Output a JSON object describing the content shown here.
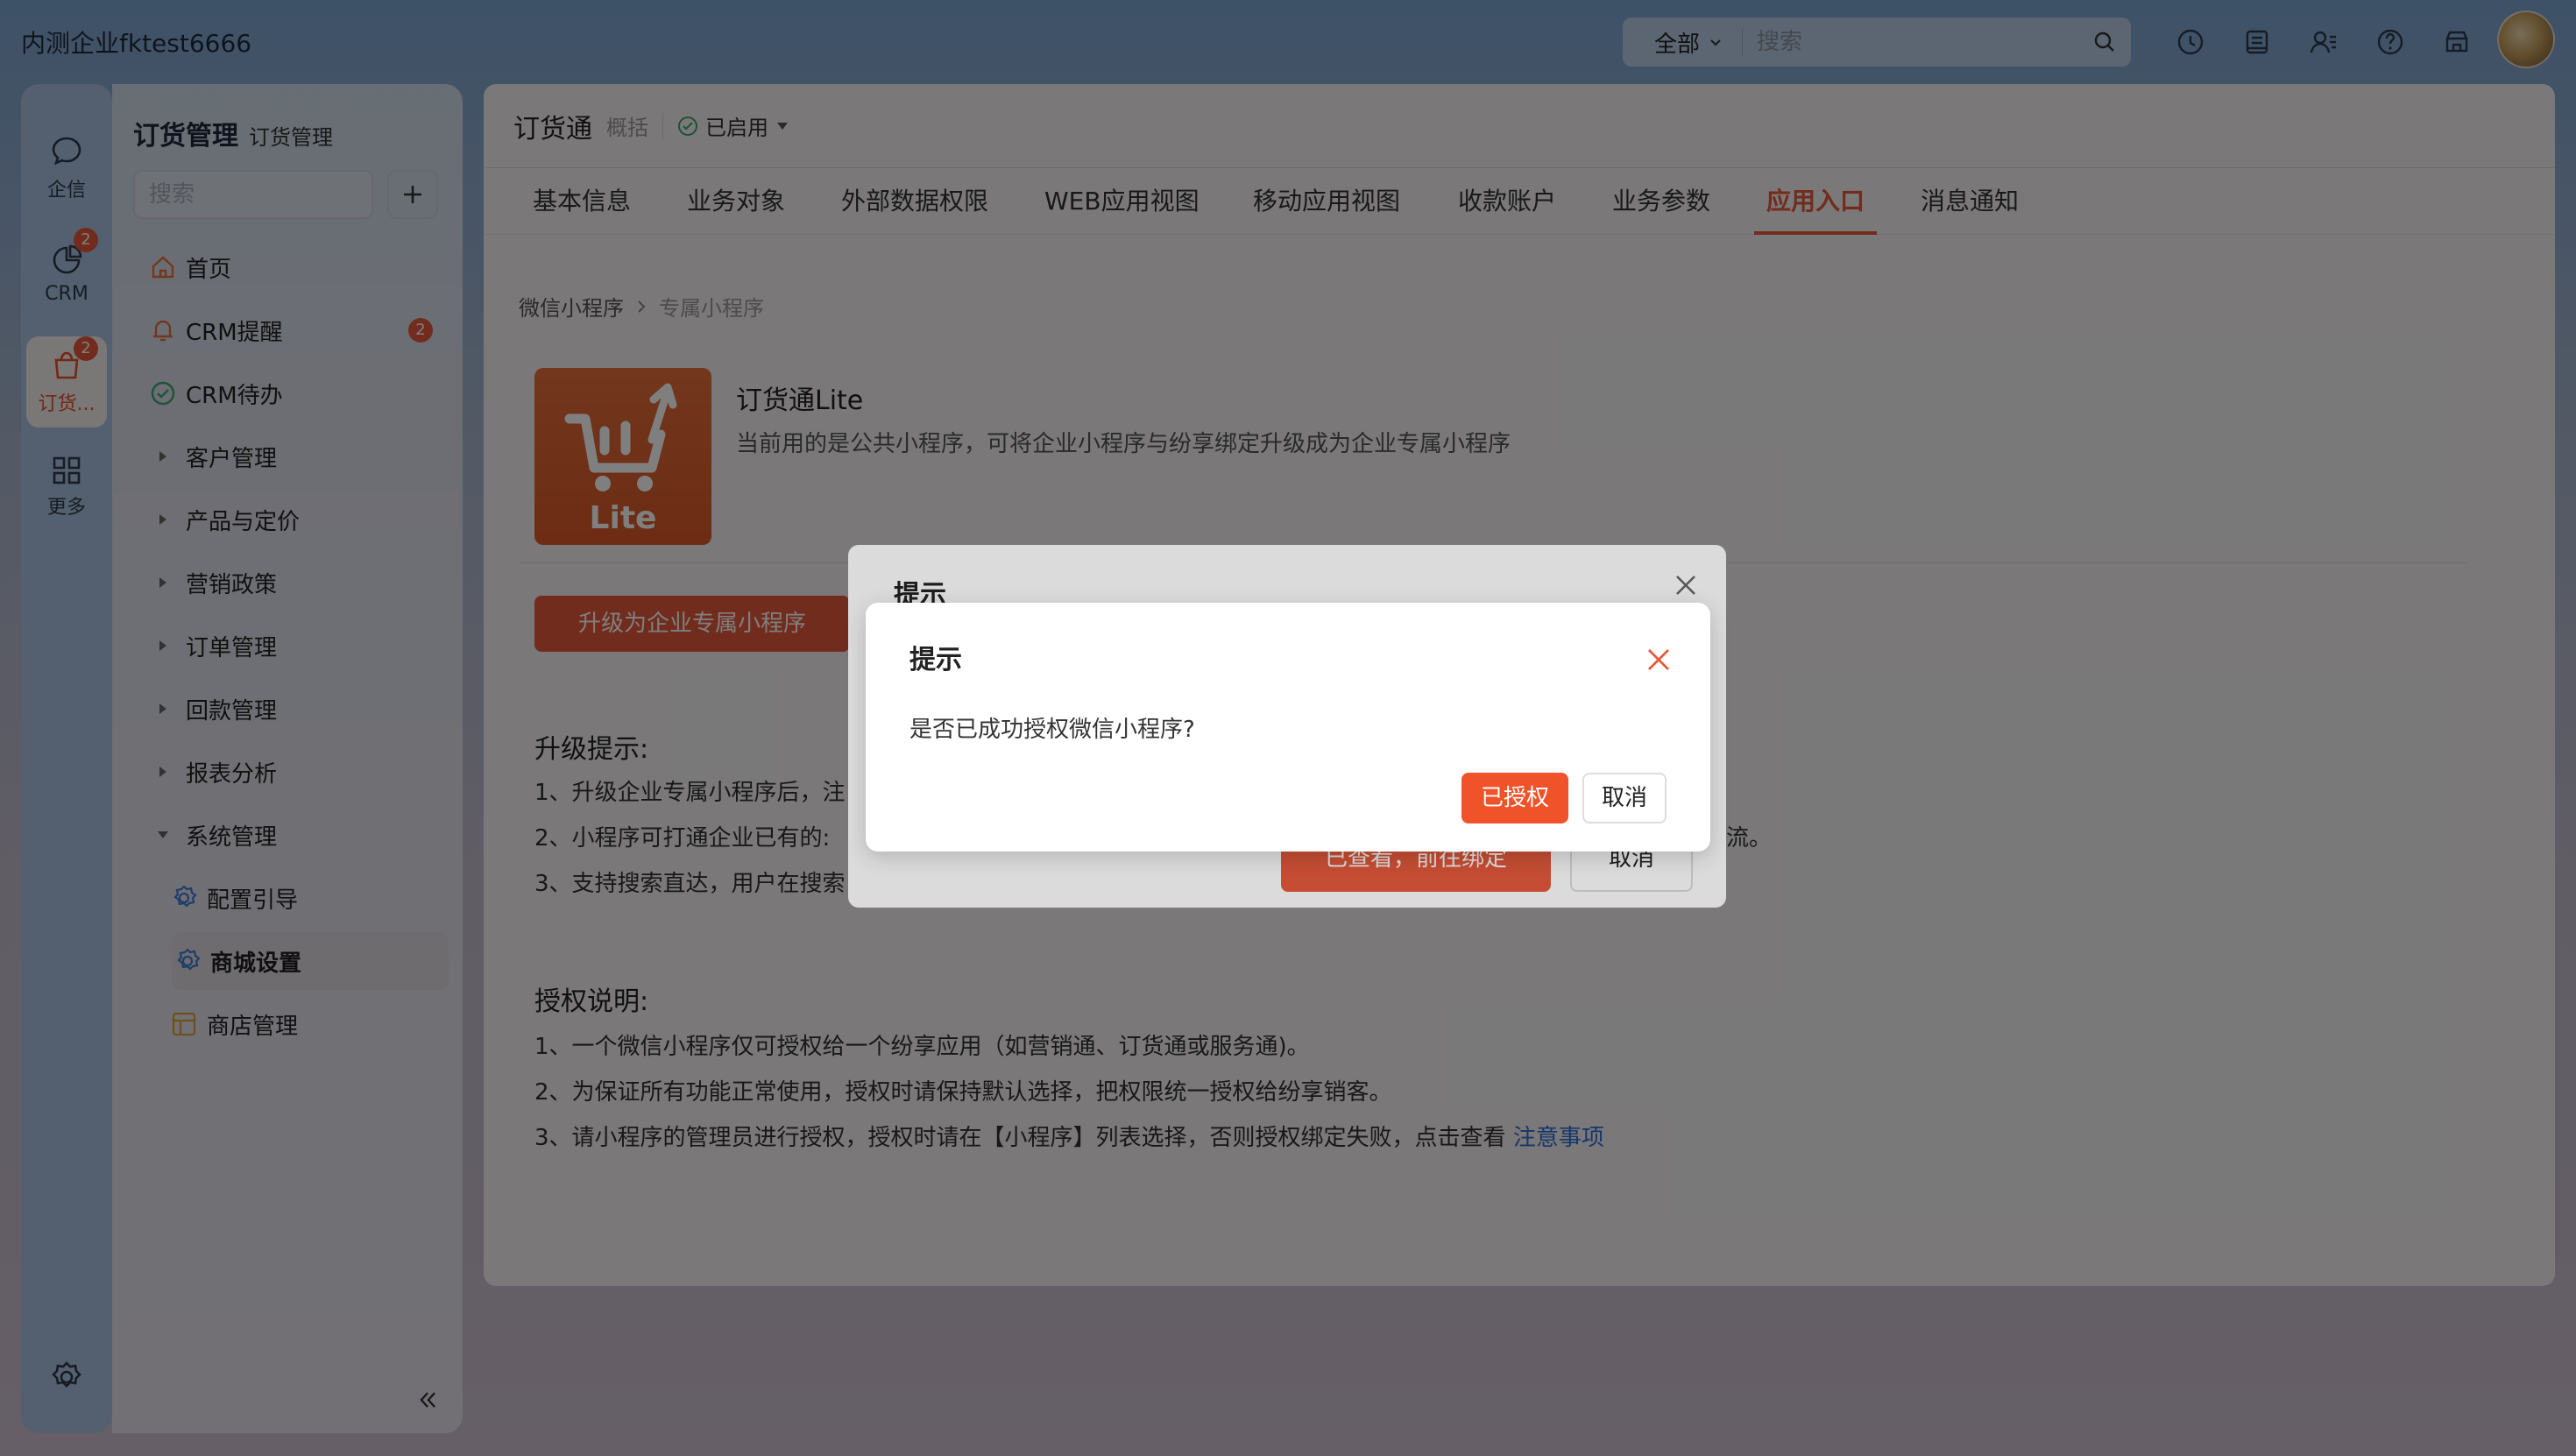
{
  "topbar": {
    "company": "内测企业fktest6666",
    "scope_label": "全部",
    "search_placeholder": "搜索",
    "icons": [
      "clock-icon",
      "notebook-icon",
      "contacts-icon",
      "help-icon",
      "store-icon"
    ]
  },
  "rail": {
    "items": [
      {
        "label": "企信",
        "icon": "chat-icon"
      },
      {
        "label": "CRM",
        "icon": "pie-chart-icon",
        "badge": "2"
      },
      {
        "label": "订货...",
        "icon": "bag-icon",
        "badge": "2",
        "active": true
      },
      {
        "label": "更多",
        "icon": "grid-icon"
      }
    ]
  },
  "nav": {
    "title": "订货管理",
    "subtitle": "订货管理",
    "search_placeholder": "搜索",
    "items": [
      {
        "label": "首页",
        "icon": "home-icon"
      },
      {
        "label": "CRM提醒",
        "icon": "bell-icon",
        "badge": "2"
      },
      {
        "label": "CRM待办",
        "icon": "check-circle-icon"
      },
      {
        "label": "客户管理",
        "expandable": true
      },
      {
        "label": "产品与定价",
        "expandable": true
      },
      {
        "label": "营销政策",
        "expandable": true
      },
      {
        "label": "订单管理",
        "expandable": true
      },
      {
        "label": "回款管理",
        "expandable": true
      },
      {
        "label": "报表分析",
        "expandable": true
      },
      {
        "label": "系统管理",
        "expanded": true
      },
      {
        "label": "配置引导",
        "icon": "gear-icon",
        "child": true
      },
      {
        "label": "商城设置",
        "icon": "gear-icon",
        "child": true,
        "selected": true
      },
      {
        "label": "商店管理",
        "icon": "shop-icon",
        "child": true
      }
    ]
  },
  "app": {
    "name": "订货通",
    "overview": "概括",
    "status": "已启用"
  },
  "tabs": [
    "基本信息",
    "业务对象",
    "外部数据权限",
    "WEB应用视图",
    "移动应用视图",
    "收款账户",
    "业务参数",
    "应用入口",
    "消息通知"
  ],
  "content": {
    "breadcrumb": [
      "微信小程序",
      "专属小程序"
    ],
    "logo_text": "Lite",
    "lite_title": "订货通Lite",
    "lite_desc": "当前用的是公共小程序，可将企业小程序与纷享绑定升级成为企业专属小程序",
    "upgrade_button": "升级为企业专属小程序",
    "upgrade_title": "升级提示:",
    "upgrade_lines": [
      "1、升级企业专属小程序后，注",
      "2、小程序可打通企业已有的:",
      "3、支持搜索直达，用户在搜索"
    ],
    "upgrade_tail": "流。",
    "auth_title": "授权说明:",
    "auth_lines": [
      "1、一个微信小程序仅可授权给一个纷享应用（如营销通、订货通或服务通)。",
      "2、为保证所有功能正常使用，授权时请保持默认选择，把权限统一授权给纷享销客。",
      "3、请小程序的管理员进行授权，授权时请在【小程序】列表选择，否则授权绑定失败，点击查看 "
    ],
    "auth_link": "注意事项"
  },
  "back_dialog": {
    "title": "提示",
    "primary": "已查看，前往绑定",
    "cancel": "取消"
  },
  "dialog": {
    "title": "提示",
    "message": "是否已成功授权微信小程序?",
    "confirm": "已授权",
    "cancel": "取消"
  },
  "colors": {
    "accent": "#e55a3c",
    "link": "#2f6fd6"
  }
}
